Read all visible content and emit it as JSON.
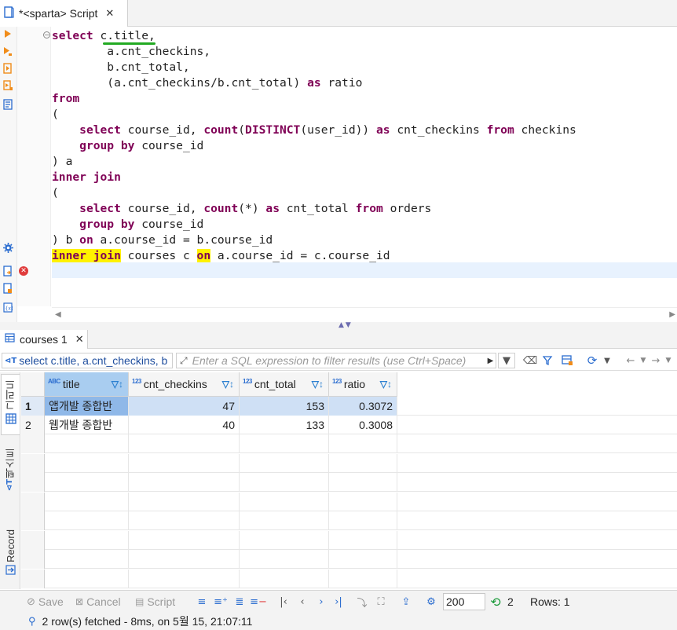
{
  "editor_tab": {
    "title": "*<sparta> Script",
    "icon": "script-file-icon",
    "close_label": "✕"
  },
  "code": {
    "lines": [
      [
        {
          "t": "select",
          "k": "kw"
        },
        {
          "t": " c.title,",
          "k": ""
        }
      ],
      [
        {
          "t": "        a.cnt_checkins,",
          "k": ""
        }
      ],
      [
        {
          "t": "        b.cnt_total,",
          "k": ""
        }
      ],
      [
        {
          "t": "        (a.cnt_checkins/b.cnt_total) ",
          "k": ""
        },
        {
          "t": "as",
          "k": "kw"
        },
        {
          "t": " ratio",
          "k": ""
        }
      ],
      [
        {
          "t": "from",
          "k": "kw"
        }
      ],
      [
        {
          "t": "(",
          "k": ""
        }
      ],
      [
        {
          "t": "    ",
          "k": ""
        },
        {
          "t": "select",
          "k": "kw"
        },
        {
          "t": " course_id, ",
          "k": ""
        },
        {
          "t": "count",
          "k": "kw"
        },
        {
          "t": "(",
          "k": ""
        },
        {
          "t": "DISTINCT",
          "k": "kw"
        },
        {
          "t": "(user_id)) ",
          "k": ""
        },
        {
          "t": "as",
          "k": "kw"
        },
        {
          "t": " cnt_checkins ",
          "k": ""
        },
        {
          "t": "from",
          "k": "kw"
        },
        {
          "t": " checkins",
          "k": ""
        }
      ],
      [
        {
          "t": "    ",
          "k": ""
        },
        {
          "t": "group by",
          "k": "kw"
        },
        {
          "t": " course_id",
          "k": ""
        }
      ],
      [
        {
          "t": ") a",
          "k": ""
        }
      ],
      [
        {
          "t": "inner join",
          "k": "kw"
        }
      ],
      [
        {
          "t": "(",
          "k": ""
        }
      ],
      [
        {
          "t": "    ",
          "k": ""
        },
        {
          "t": "select",
          "k": "kw"
        },
        {
          "t": " course_id, ",
          "k": ""
        },
        {
          "t": "count",
          "k": "kw"
        },
        {
          "t": "(*) ",
          "k": ""
        },
        {
          "t": "as",
          "k": "kw"
        },
        {
          "t": " cnt_total ",
          "k": ""
        },
        {
          "t": "from",
          "k": "kw"
        },
        {
          "t": " orders",
          "k": ""
        }
      ],
      [
        {
          "t": "    ",
          "k": ""
        },
        {
          "t": "group by",
          "k": "kw"
        },
        {
          "t": " course_id",
          "k": ""
        }
      ],
      [
        {
          "t": ") b ",
          "k": ""
        },
        {
          "t": "on",
          "k": "kw"
        },
        {
          "t": " a.course_id = b.course_id",
          "k": ""
        }
      ],
      [
        {
          "t": "inner join",
          "k": "kw hl"
        },
        {
          "t": " courses c ",
          "k": ""
        },
        {
          "t": "on",
          "k": "kw hl"
        },
        {
          "t": " a.course_id = c.course_id",
          "k": ""
        }
      ],
      [
        {
          "t": "",
          "k": ""
        }
      ]
    ]
  },
  "results_tab": {
    "title": "courses 1",
    "close_label": "✕"
  },
  "filter_bar": {
    "query_text": "select c.title, a.cnt_checkins, b",
    "filter_placeholder": "Enter a SQL expression to filter results (use Ctrl+Space)"
  },
  "side_tabs": {
    "grid": "그리드",
    "text": "텍스트",
    "record": "Record"
  },
  "grid": {
    "columns": [
      {
        "name": "title",
        "type_badge": "ABC"
      },
      {
        "name": "cnt_checkins",
        "type_badge": "123"
      },
      {
        "name": "cnt_total",
        "type_badge": "123"
      },
      {
        "name": "ratio",
        "type_badge": "123"
      }
    ],
    "rows": [
      {
        "num": "1",
        "title": "앱개발 종합반",
        "cnt_checkins": "47",
        "cnt_total": "153",
        "ratio": "0.3072"
      },
      {
        "num": "2",
        "title": "웹개발 종합반",
        "cnt_checkins": "40",
        "cnt_total": "133",
        "ratio": "0.3008"
      }
    ],
    "selected_row": 0
  },
  "bottom_toolbar": {
    "save_label": "Save",
    "cancel_label": "Cancel",
    "script_label": "Script",
    "fetch_size": "200",
    "refresh_count": "2",
    "rows_label": "Rows: 1"
  },
  "status": {
    "text": "2 row(s) fetched - 8ms, on 5월 15, 21:07:11"
  },
  "colors": {
    "keyword": "#7f0055",
    "highlight": "#fff200",
    "selection": "#cfe0f5",
    "accent": "#2a6ccf",
    "error": "#e03b3b"
  }
}
